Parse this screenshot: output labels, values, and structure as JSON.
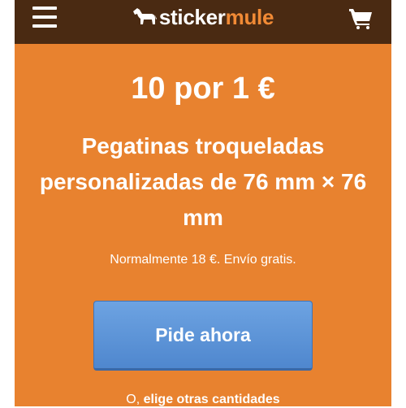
{
  "header": {
    "logo_prefix": "sticker",
    "logo_suffix": "mule",
    "menu_icon": "hamburger-menu-icon",
    "cart_icon": "shopping-cart-icon",
    "logo_icon": "mule-icon"
  },
  "promo": {
    "price": "10 por 1 €",
    "product": "Pegatinas troqueladas personalizadas de 76 mm × 76 mm",
    "note": "Normalmente 18 €. Envío gratis.",
    "cta_label": "Pide ahora",
    "alt_prefix": "O, ",
    "alt_link": "elige otras cantidades"
  },
  "colors": {
    "header_bg": "#4a2a12",
    "banner_bg": "#e8822f",
    "accent": "#f18a35",
    "button": "#5b93d8"
  }
}
